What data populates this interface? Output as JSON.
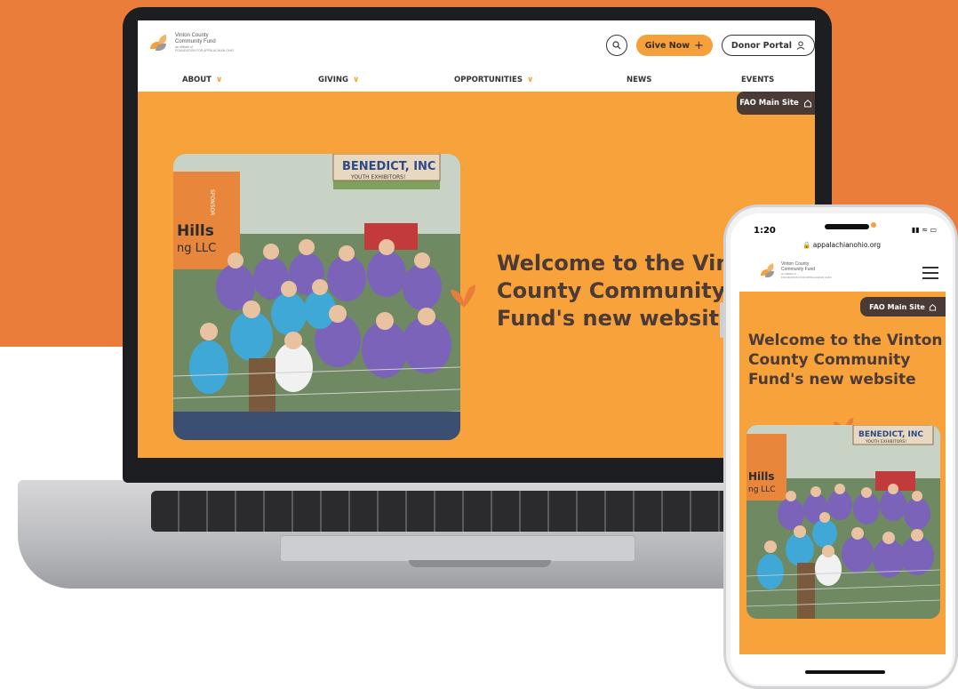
{
  "brand": {
    "accent": "#f7a23a",
    "dark": "#4b3a35",
    "backdrop": "#ea7d3a"
  },
  "laptop_site": {
    "logo": {
      "line1": "Vinton County",
      "line2": "Community Fund",
      "line3": "an affiliate of",
      "line4": "FOUNDATION FOR APPALACHIAN OHIO"
    },
    "actions": {
      "search_icon": "search-icon",
      "give_label": "Give Now",
      "give_icon": "+",
      "donor_label": "Donor Portal",
      "donor_icon": "user-icon"
    },
    "nav": [
      {
        "label": "ABOUT",
        "has_menu": true
      },
      {
        "label": "GIVING",
        "has_menu": true
      },
      {
        "label": "OPPORTUNITIES",
        "has_menu": true
      },
      {
        "label": "NEWS",
        "has_menu": false
      },
      {
        "label": "EVENTS",
        "has_menu": false
      }
    ],
    "fao_label": "FAO Main Site",
    "hero_title_line1": "Welcome to the Vint",
    "hero_title_line2": "County Community",
    "hero_title_line3": "Fund's new website",
    "photo_banner": "BENEDICT, INC",
    "photo_sub": "YOUTH EXHIBITORS!",
    "photo_sign": "Hills",
    "photo_sign2": "ng LLC",
    "photo_sponsor": "SPONSOR"
  },
  "phone_site": {
    "time": "1:20",
    "url": "appalachianohio.org",
    "logo": {
      "line1": "Vinton County",
      "line2": "Community Fund",
      "line3": "an affiliate of",
      "line4": "FOUNDATION FOR APPALACHIAN OHIO"
    },
    "fao_label": "FAO Main Site",
    "hero_title_line1": "Welcome to the Vinton",
    "hero_title_line2": "County Community",
    "hero_title_line3": "Fund's new website",
    "photo_banner": "BENEDICT, INC",
    "photo_sub": "YOUTH EXHIBITORS!",
    "photo_sign": "Hills",
    "photo_sign2": "ng LLC"
  }
}
